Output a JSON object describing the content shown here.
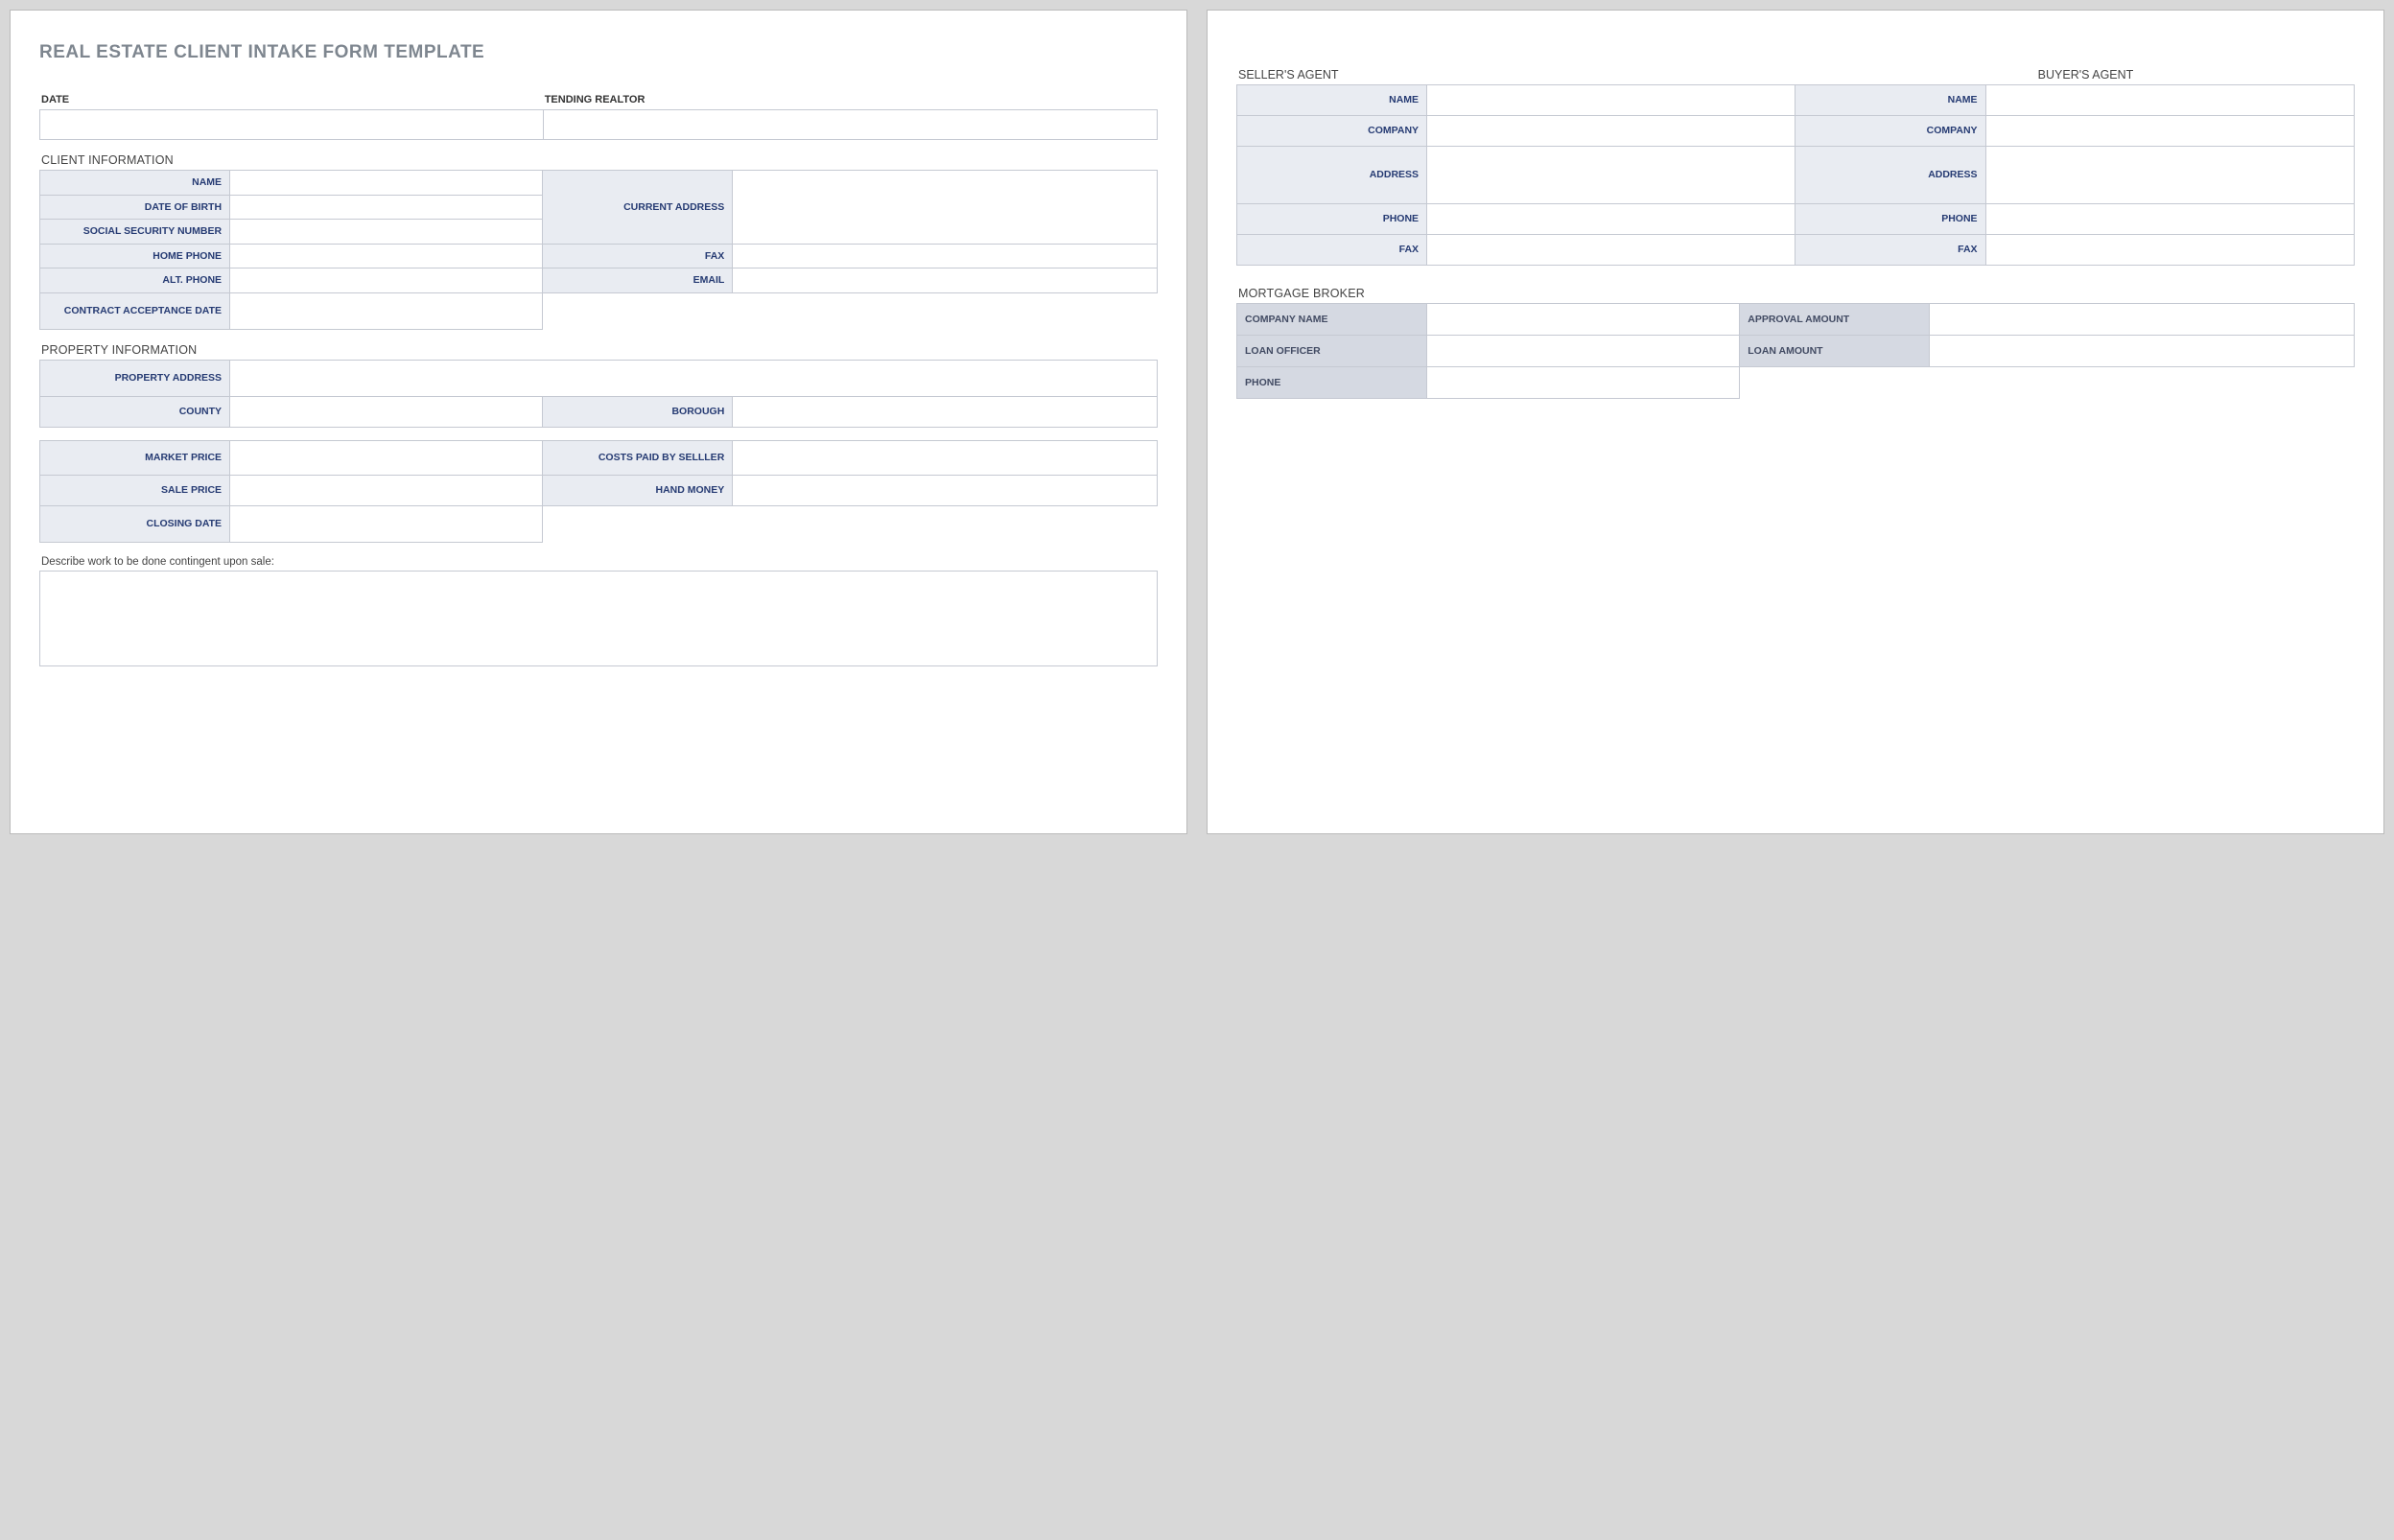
{
  "title": "REAL ESTATE CLIENT INTAKE FORM TEMPLATE",
  "top": {
    "date": "DATE",
    "tending": "TENDING REALTOR"
  },
  "sections": {
    "client": "CLIENT INFORMATION",
    "property": "PROPERTY INFORMATION",
    "sellers_agent": "SELLER'S AGENT",
    "buyers_agent": "BUYER'S AGENT",
    "mortgage": "MORTGAGE BROKER"
  },
  "labels": {
    "name": "NAME",
    "dob": "DATE OF BIRTH",
    "ssn": "SOCIAL SECURITY NUMBER",
    "home_phone": "HOME PHONE",
    "alt_phone": "ALT. PHONE",
    "contract_date": "CONTRACT ACCEPTANCE DATE",
    "current_address": "CURRENT ADDRESS",
    "fax": "FAX",
    "email": "EMAIL",
    "property_address": "PROPERTY ADDRESS",
    "county": "COUNTY",
    "borough": "BOROUGH",
    "market_price": "MARKET PRICE",
    "sale_price": "SALE PRICE",
    "closing_date": "CLOSING DATE",
    "costs_paid": "COSTS PAID BY SELLLER",
    "hand_money": "HAND MONEY",
    "describe": "Describe work to be done contingent upon sale:",
    "company": "COMPANY",
    "address": "ADDRESS",
    "phone": "PHONE",
    "agent_fax": "FAX",
    "company_name": "COMPANY NAME",
    "loan_officer": "LOAN OFFICER",
    "broker_phone": "PHONE",
    "approval_amount": "APPROVAL AMOUNT",
    "loan_amount": "LOAN AMOUNT"
  }
}
